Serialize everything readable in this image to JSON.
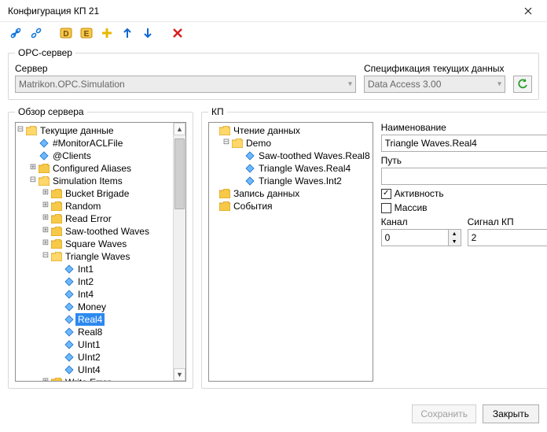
{
  "window": {
    "title": "Конфигурация КП 21"
  },
  "toolbar": {
    "icons": [
      "link",
      "unlink",
      "sep",
      "d",
      "e",
      "plus",
      "up",
      "down",
      "sep",
      "x"
    ]
  },
  "opc": {
    "legend": "OPC-сервер",
    "server_label": "Сервер",
    "server_value": "Matrikon.OPC.Simulation",
    "spec_label": "Спецификация текущих данных",
    "spec_value": "Data Access 3.00"
  },
  "serverBrowser": {
    "legend": "Обзор сервера",
    "root": "Текущие данные",
    "items": [
      "#MonitorACLFile",
      "@Clients"
    ],
    "folders": [
      {
        "name": "Configured Aliases",
        "open": false
      },
      {
        "name": "Simulation Items",
        "open": true,
        "children": [
          {
            "name": "Bucket Brigade",
            "open": false
          },
          {
            "name": "Random",
            "open": false
          },
          {
            "name": "Read Error",
            "open": false
          },
          {
            "name": "Saw-toothed Waves",
            "open": false
          },
          {
            "name": "Square Waves",
            "open": false
          },
          {
            "name": "Triangle Waves",
            "open": true,
            "leaves": [
              "Int1",
              "Int2",
              "Int4",
              "Money",
              "Real4",
              "Real8",
              "UInt1",
              "UInt2",
              "UInt4"
            ]
          },
          {
            "name": "Write Error",
            "open": false
          }
        ]
      }
    ],
    "selected_leaf": "Real4"
  },
  "kp": {
    "legend": "КП",
    "tree": {
      "root1": "Чтение данных",
      "demo": "Demo",
      "leaves": [
        "Saw-toothed Waves.Real8",
        "Triangle Waves.Real4",
        "Triangle Waves.Int2"
      ],
      "root2": "Запись данных",
      "root3": "События"
    },
    "form": {
      "name_label": "Наименование",
      "name_value": "Triangle Waves.Real4",
      "path_label": "Путь",
      "path_value": "",
      "activity_label": "Активность",
      "activity_checked": true,
      "array_label": "Массив",
      "array_checked": false,
      "channel_label": "Канал",
      "channel_value": "0",
      "signal_label": "Сигнал КП",
      "signal_value": "2"
    }
  },
  "buttons": {
    "save": "Сохранить",
    "close": "Закрыть"
  }
}
